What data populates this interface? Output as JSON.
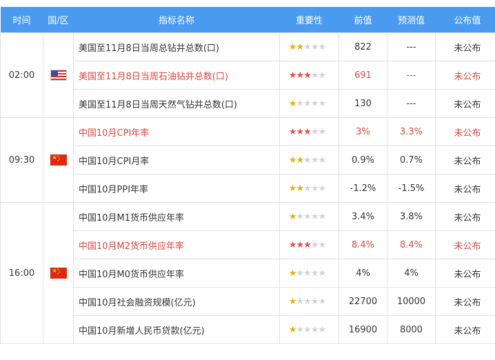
{
  "header": {
    "time": "时间",
    "region": "国/区",
    "indicator": "指标名称",
    "importance": "重要性",
    "previous": "前值",
    "forecast": "预测值",
    "published": "公布值"
  },
  "groups": [
    {
      "time": "02:00",
      "flag_icon": "us-flag-icon",
      "rows": [
        {
          "name": "美国至11月8日当周总钻井总数(口)",
          "importance": 2,
          "previous": "822",
          "forecast": "---",
          "published": "未公布",
          "highlight": false
        },
        {
          "name": "美国至11月8日当周石油钻井总数(口)",
          "importance": 3,
          "previous": "691",
          "forecast": "---",
          "published": "未公布",
          "highlight": true
        },
        {
          "name": "美国至11月8日当周天然气钻井总数(口)",
          "importance": 1,
          "previous": "130",
          "forecast": "---",
          "published": "未公布",
          "highlight": false
        }
      ]
    },
    {
      "time": "09:30",
      "flag_icon": "china-flag-icon",
      "rows": [
        {
          "name": "中国10月CPI年率",
          "importance": 3,
          "previous": "3%",
          "forecast": "3.3%",
          "published": "未公布",
          "highlight": true
        },
        {
          "name": "中国10月CPI月率",
          "importance": 2,
          "previous": "0.9%",
          "forecast": "0.7%",
          "published": "未公布",
          "highlight": false
        },
        {
          "name": "中国10月PPI年率",
          "importance": 2,
          "previous": "-1.2%",
          "forecast": "-1.5%",
          "published": "未公布",
          "highlight": false
        }
      ]
    },
    {
      "time": "16:00",
      "flag_icon": "china-flag-icon",
      "rows": [
        {
          "name": "中国10月M1货币供应年率",
          "importance": 1,
          "previous": "3.4%",
          "forecast": "3.8%",
          "published": "未公布",
          "highlight": false
        },
        {
          "name": "中国10月M2货币供应年率",
          "importance": 3,
          "previous": "8.4%",
          "forecast": "8.4%",
          "published": "未公布",
          "highlight": true
        },
        {
          "name": "中国10月M0货币供应年率",
          "importance": 1,
          "previous": "4%",
          "forecast": "4%",
          "published": "未公布",
          "highlight": false
        },
        {
          "name": "中国10月社会融资规模(亿元)",
          "importance": 1,
          "previous": "22700",
          "forecast": "10000",
          "published": "未公布",
          "highlight": false
        },
        {
          "name": "中国10月新增人民币贷款(亿元)",
          "importance": 1,
          "previous": "16900",
          "forecast": "8000",
          "published": "未公布",
          "highlight": false
        }
      ]
    }
  ],
  "colors": {
    "header_bg": "#4a9bf0",
    "highlight_text": "#e0453b",
    "star_high": "#ef4b4b",
    "star_mid": "#e9b000",
    "star_off": "#cfd3d9"
  }
}
